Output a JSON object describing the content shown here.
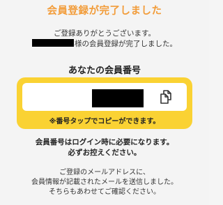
{
  "header": {
    "title": "会員登録が完了しました"
  },
  "message": {
    "thanks": "ご登録ありがとうございます。",
    "name_suffix": "様の会員登録が完了しました。"
  },
  "member": {
    "heading": "あなたの会員番号",
    "copy_icon": "copy-icon",
    "tap_note": "※番号タップでコピーができます。"
  },
  "notice": {
    "line1": "会員番号はログイン時に必要になります。",
    "line2": "必ずお控えください。"
  },
  "email_info": {
    "line1": "ご登録のメールアドレスに、",
    "line2": "会員情報が記載されたメールを送信しました。",
    "line3": "そちらもあわせてご確認ください。"
  },
  "colors": {
    "title": "#f29c39",
    "card": "#fad233",
    "background": "#f4f4f4"
  }
}
